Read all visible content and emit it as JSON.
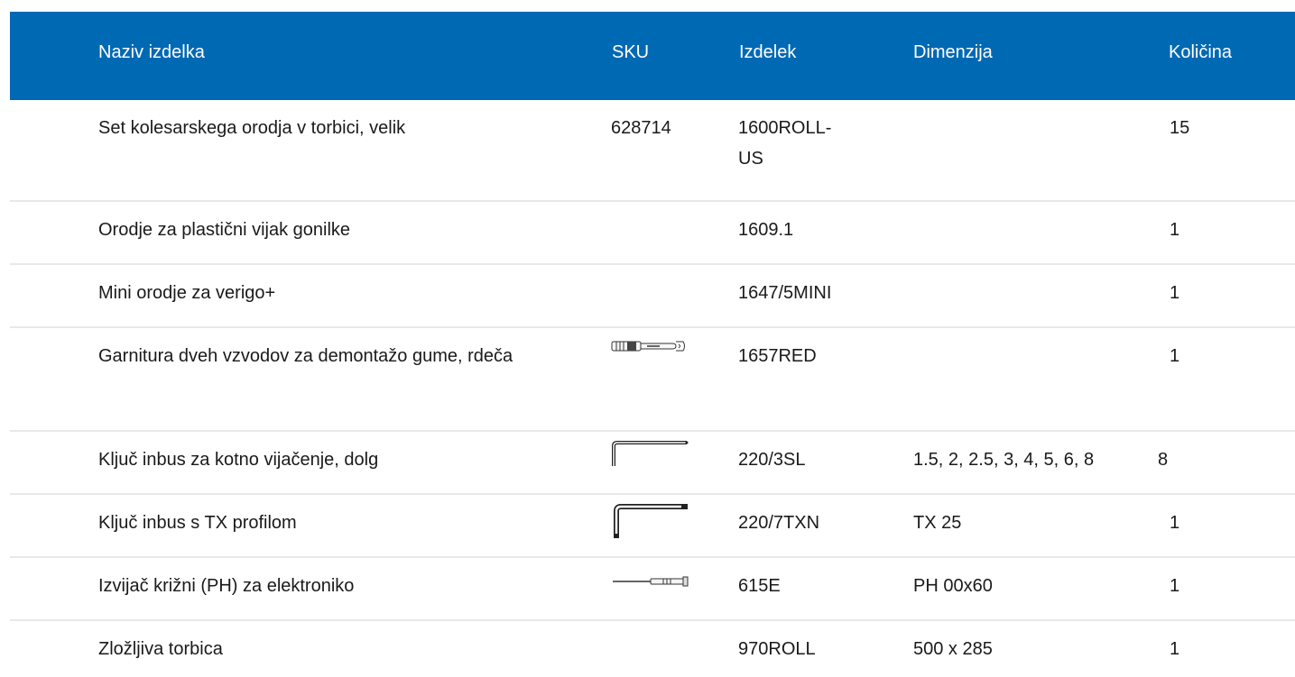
{
  "header": {
    "name": "Naziv izdelka",
    "sku": "SKU",
    "article": "Izdelek",
    "dimension": "Dimenzija",
    "quantity": "Količina"
  },
  "rows": [
    {
      "name": "Set kolesarskega orodja v torbici, velik",
      "sku": "628714",
      "article": "1600ROLL-\nUS",
      "dimension": "",
      "quantity": "15",
      "icon": ""
    },
    {
      "name": "Orodje za plastični vijak gonilke",
      "sku": "",
      "article": "1609.1",
      "dimension": "",
      "quantity": "1",
      "icon": ""
    },
    {
      "name": "Mini orodje za verigo+",
      "sku": "",
      "article": "1647/5MINI",
      "dimension": "",
      "quantity": "1",
      "icon": ""
    },
    {
      "name": "Garnitura dveh vzvodov za demontažo gume, rdeča",
      "sku": "",
      "article": "1657RED",
      "dimension": "",
      "quantity": "1",
      "icon": "tire-lever-icon"
    },
    {
      "name": "Ključ inbus za kotno vijačenje, dolg",
      "sku": "",
      "article": "220/3SL",
      "dimension": "1.5, 2, 2.5, 3, 4, 5, 6, 8",
      "quantity": "8",
      "icon": "allen-key-icon"
    },
    {
      "name": "Ključ inbus s TX profilom",
      "sku": "",
      "article": "220/7TXN",
      "dimension": "TX 25",
      "quantity": "1",
      "icon": "torx-key-icon"
    },
    {
      "name": "Izvijač križni (PH) za elektroniko",
      "sku": "",
      "article": "615E",
      "dimension": "PH 00x60",
      "quantity": "1",
      "icon": "screwdriver-icon"
    },
    {
      "name": "Zložljiva torbica",
      "sku": "",
      "article": "970ROLL",
      "dimension": "500 x 285",
      "quantity": "1",
      "icon": ""
    }
  ]
}
